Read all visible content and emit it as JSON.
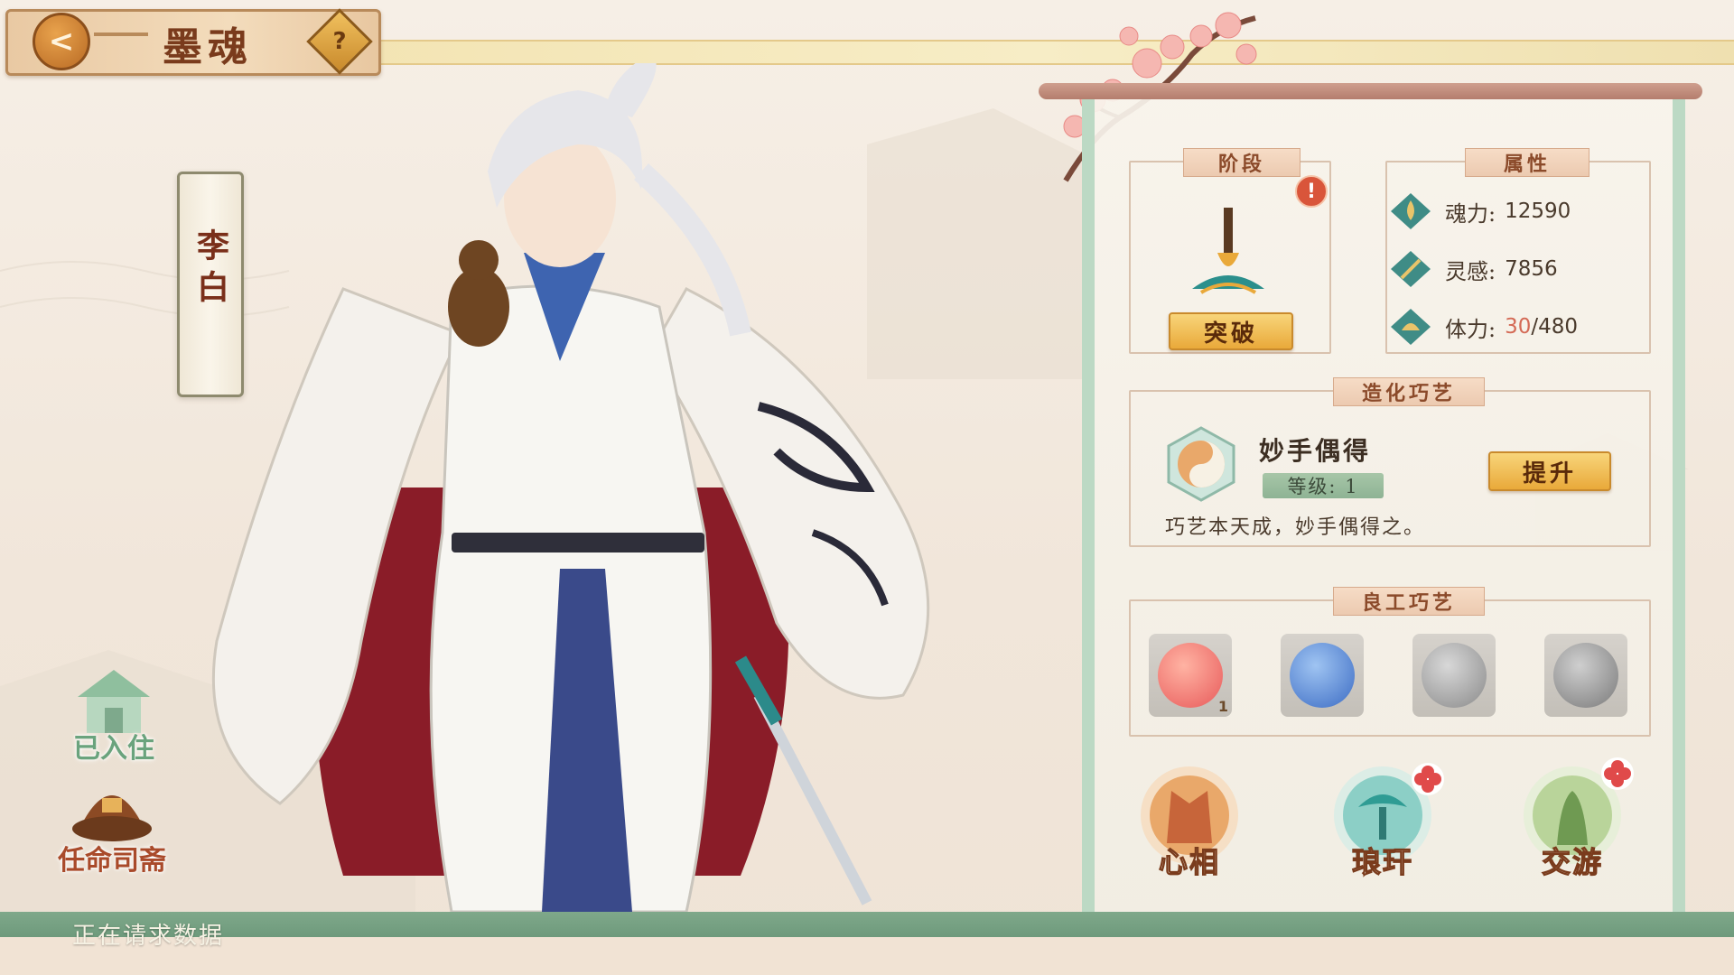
{
  "header": {
    "back_label": "<",
    "title": "墨魂",
    "help_label": "?"
  },
  "character": {
    "name": "李白"
  },
  "side_actions": [
    {
      "label": "已入住",
      "icon": "residence-house-icon"
    },
    {
      "label": "任命司斋",
      "icon": "appoint-hat-icon"
    }
  ],
  "status": {
    "text": "正在请求数据"
  },
  "panel": {
    "stage": {
      "tag": "阶段",
      "alert": "!",
      "breakthrough_label": "突破"
    },
    "attributes": {
      "tag": "属性",
      "items": [
        {
          "label": "魂力:",
          "value": "12590",
          "icon": "soul-power-icon"
        },
        {
          "label": "灵感:",
          "value": "7856",
          "icon": "inspiration-brush-icon"
        },
        {
          "label": "体力:",
          "current": "30",
          "max": "/480",
          "icon": "stamina-icon"
        }
      ]
    },
    "creation_craft": {
      "tag": "造化巧艺",
      "skill_name": "妙手偶得",
      "level": "等级: 1",
      "description": "巧艺本天成，妙手偶得之。",
      "upgrade_label": "提升"
    },
    "fine_craft": {
      "tag": "良工巧艺",
      "slots": [
        {
          "icon": "red-craft-icon",
          "count": "1"
        },
        {
          "icon": "blue-craft-icon",
          "count": ""
        },
        {
          "icon": "gray-cloud-craft-icon",
          "count": ""
        },
        {
          "icon": "gray-coin-craft-icon",
          "count": ""
        }
      ]
    },
    "features": [
      {
        "label": "心相",
        "icon": "robe-icon"
      },
      {
        "label": "琅玕",
        "icon": "bonsai-tree-icon"
      },
      {
        "label": "交游",
        "icon": "companion-icon"
      }
    ]
  },
  "colors": {
    "accent_gold": "#e9a93a",
    "panel_green": "#bcd9c4",
    "alert_red": "#d9553a",
    "stamina_current": "#d46a55"
  }
}
